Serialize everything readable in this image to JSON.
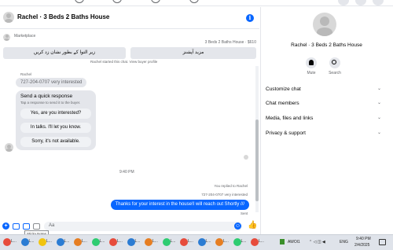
{
  "header": {
    "title": "Rachel · 3 Beds 2 Baths House"
  },
  "marketplace": {
    "label": "Marketplace",
    "listing": "3 Beds 2 Baths House · $610",
    "quick_buttons": [
      {
        "label": "زیر التوا کے بطور نشان زد کریں"
      },
      {
        "label": "مزید آپشنز"
      }
    ]
  },
  "conversation": {
    "partial_top_text": "Rachel started this chat. View buyer profile",
    "sender_name": "Rachel",
    "incoming_message": "727-204-0707 very interested",
    "quick_response": {
      "title": "Send a quick response",
      "subtitle": "Tap a response to send it to the buyer.",
      "options": [
        {
          "label": "Yes, are you interested?"
        },
        {
          "label": "In talks. I'll let you know."
        },
        {
          "label": "Sorry, it's not available."
        }
      ]
    },
    "timestamp": "9:40 PM",
    "replied_label": "You replied to Rachel",
    "quoted_message": "727-204-0707 very interested",
    "outgoing_message": "Thanks for your interest in the house!I will reach out Shortly ///",
    "status": "Sent"
  },
  "composer": {
    "placeholder": "Aa",
    "tooltip": "Sticky Notes"
  },
  "right_panel": {
    "name": "Rachel · 3 Beds 2 Baths House",
    "actions": [
      {
        "label": "Mute",
        "icon": "bell-icon"
      },
      {
        "label": "Search",
        "icon": "search-icon"
      }
    ],
    "sections": [
      {
        "label": "Customize chat"
      },
      {
        "label": "Chat members"
      },
      {
        "label": "Media, files and links"
      },
      {
        "label": "Privacy & support"
      }
    ]
  },
  "taskbar": {
    "app_label": "L...",
    "wifi_label": "AWOl1",
    "language": "ENG",
    "time": "9:40 PM",
    "date": "2/4/2025"
  },
  "colors": {
    "accent": "#0866ff",
    "bubble_grey": "#e4e6eb",
    "taskbar": "#dfe3ea"
  }
}
